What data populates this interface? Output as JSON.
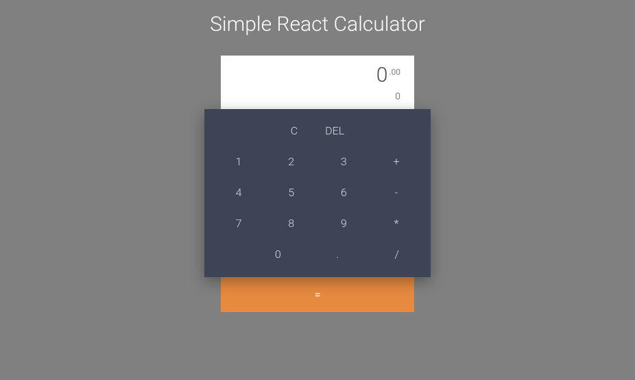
{
  "title": "Simple React Calculator",
  "display": {
    "main_integer": "0",
    "main_decimal": ".00",
    "secondary": "0"
  },
  "buttons": {
    "clear": "C",
    "delete": "DEL",
    "one": "1",
    "two": "2",
    "three": "3",
    "plus": "+",
    "four": "4",
    "five": "5",
    "six": "6",
    "minus": "-",
    "seven": "7",
    "eight": "8",
    "nine": "9",
    "multiply": "*",
    "zero": "0",
    "dot": ".",
    "divide": "/",
    "equals": "="
  }
}
